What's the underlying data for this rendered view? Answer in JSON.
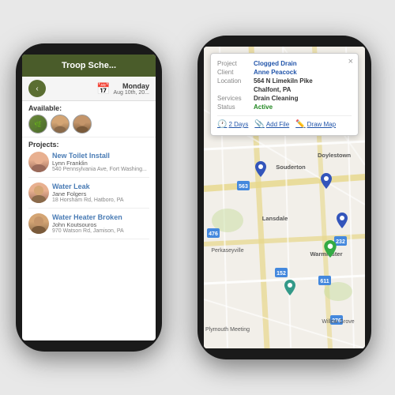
{
  "leftPhone": {
    "header": "Troop Sche...",
    "nav": {
      "backLabel": "‹",
      "dayName": "Monday",
      "dayDetail": "Aug 10th, 20..."
    },
    "availableSection": {
      "title": "Available:"
    },
    "projectsSection": {
      "title": "Projects:",
      "items": [
        {
          "title": "New Toilet Install",
          "person": "Lynn Franklin",
          "address": "540 Pennsylvania Ave, Fort Washing..."
        },
        {
          "title": "Water Leak",
          "person": "Jane Folgers",
          "address": "18 Horsham Rd, Hatboro, PA"
        },
        {
          "title": "Water Heater Broken",
          "person": "John Koutsouros",
          "address": "970 Watson Rd, Jamison, PA"
        }
      ]
    }
  },
  "rightPhone": {
    "popup": {
      "closeLabel": "×",
      "fields": [
        {
          "label": "Project",
          "value": "Clogged Drain",
          "style": "blue"
        },
        {
          "label": "Client",
          "value": "Anne Peacock",
          "style": "blue"
        },
        {
          "label": "Location",
          "value": "564 N Limekiln Pike",
          "style": "normal"
        },
        {
          "label": "",
          "value": "Chalfont, PA",
          "style": "normal"
        },
        {
          "label": "Services",
          "value": "Drain Cleaning",
          "style": "normal"
        },
        {
          "label": "Status",
          "value": "Active",
          "style": "green"
        }
      ],
      "actions": [
        {
          "icon": "🕐",
          "label": "2 Days"
        },
        {
          "icon": "📎",
          "label": "Add File"
        },
        {
          "icon": "✏️",
          "label": "Draw Map"
        }
      ]
    },
    "mapAlt": "Street map of area near Doylestown, PA"
  },
  "colors": {
    "headerBg": "#4a5c2a",
    "accent": "#2255aa",
    "activeGreen": "#228822"
  }
}
